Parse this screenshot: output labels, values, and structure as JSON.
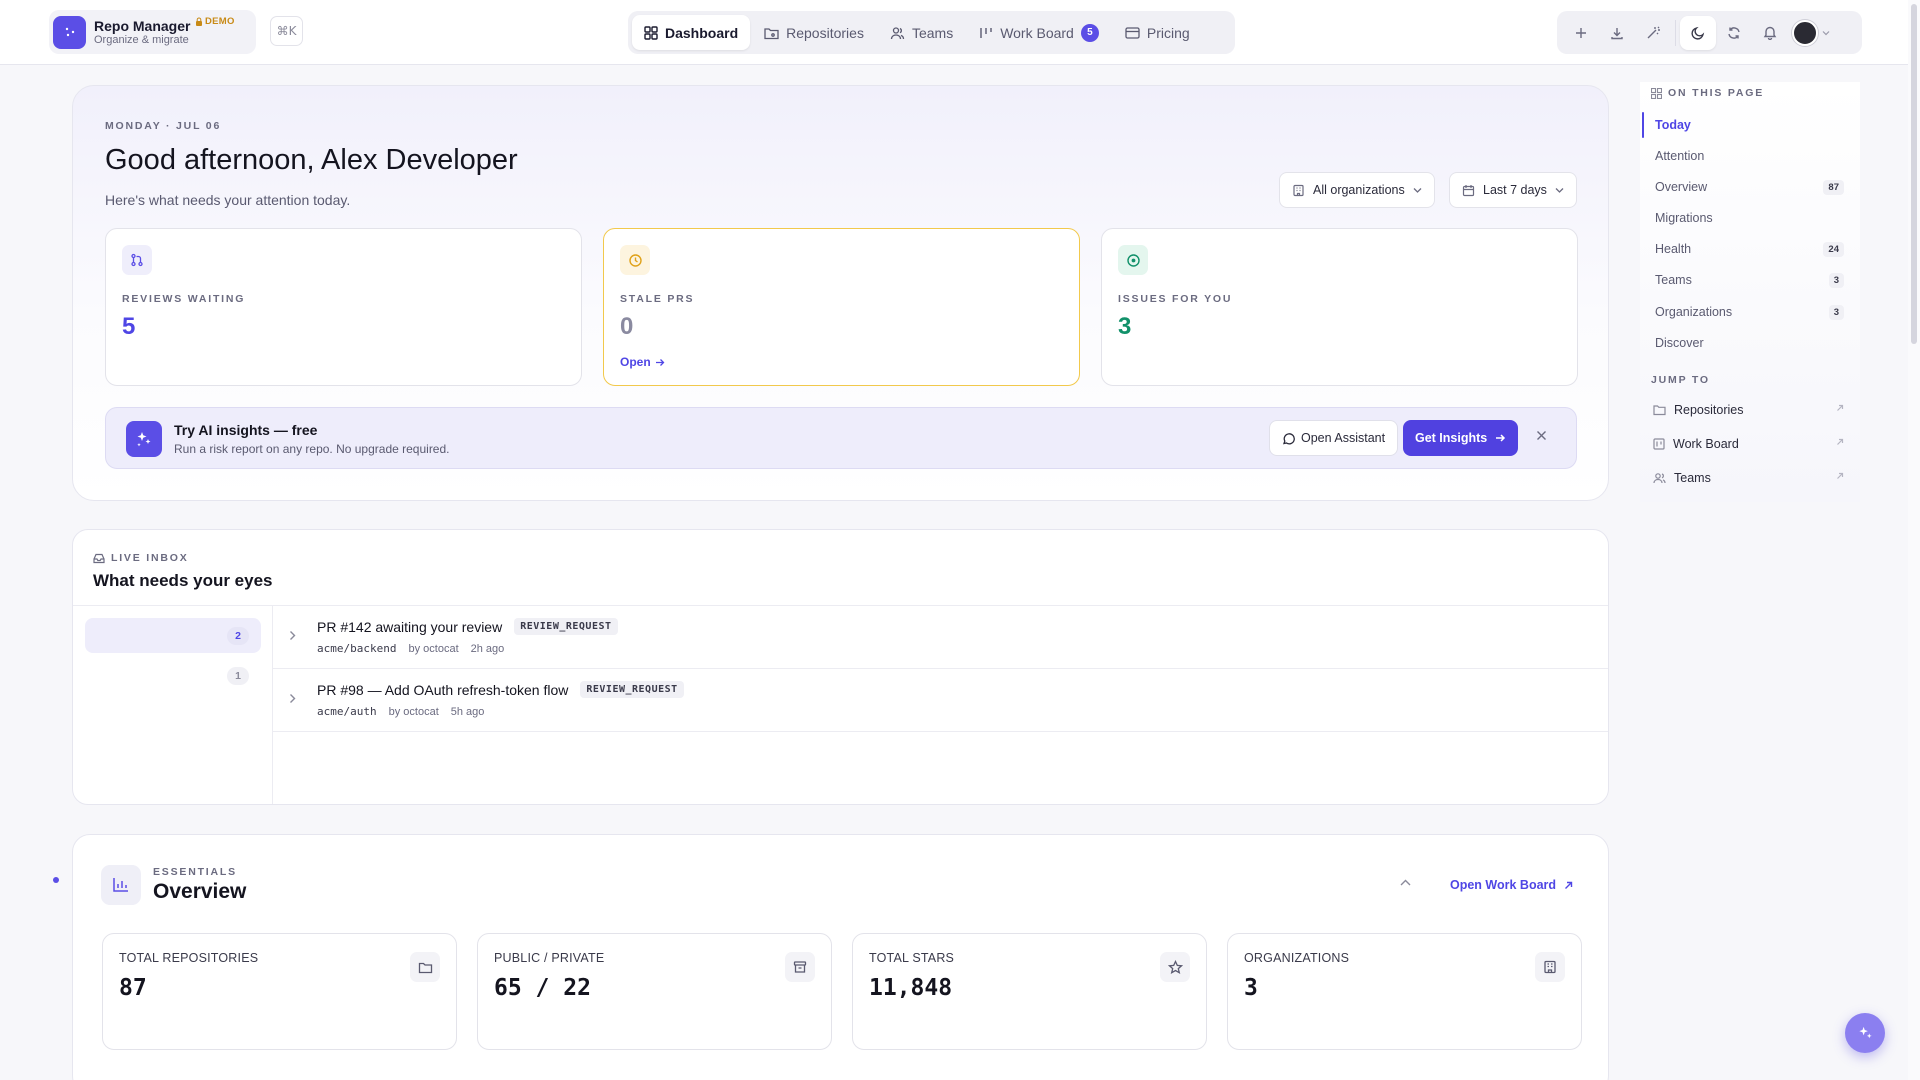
{
  "brand": {
    "name": "Repo Manager",
    "subtitle": "Organize & migrate",
    "badge": "DEMO",
    "shortcut": "⌘K"
  },
  "nav": {
    "dashboard": "Dashboard",
    "repositories": "Repositories",
    "teams": "Teams",
    "work_board": "Work Board",
    "work_board_count": "5",
    "pricing": "Pricing"
  },
  "hero": {
    "date": "MONDAY · JUL 06",
    "greeting": "Good afternoon, Alex Developer",
    "subtitle": "Here's what needs your attention today.",
    "org_filter": "All organizations",
    "range_filter": "Last 7 days"
  },
  "stats": [
    {
      "label": "REVIEWS WAITING",
      "value": "5",
      "color": "#4f46e5"
    },
    {
      "label": "STALE PRS",
      "value": "0",
      "link": "Open",
      "color": "#8a8aa0"
    },
    {
      "label": "ISSUES FOR YOU",
      "value": "3",
      "color": "#12916a"
    }
  ],
  "ai_banner": {
    "title": "Try AI insights — free",
    "subtitle": "Run a risk report on any repo. No upgrade required.",
    "assistant_button": "Open Assistant",
    "insights_button": "Get Insights"
  },
  "inbox": {
    "eyebrow": "LIVE INBOX",
    "title": "What needs your eyes",
    "filters": [
      {
        "count": "2"
      },
      {
        "count": "1"
      }
    ],
    "items": [
      {
        "title": "PR #142 awaiting your review",
        "tag": "REVIEW_REQUEST",
        "repo": "acme/backend",
        "author": "by octocat",
        "time": "2h ago"
      },
      {
        "title": "PR #98 — Add OAuth refresh-token flow",
        "tag": "REVIEW_REQUEST",
        "repo": "acme/auth",
        "author": "by octocat",
        "time": "5h ago"
      }
    ]
  },
  "overview": {
    "eyebrow": "ESSENTIALS",
    "title": "Overview",
    "link": "Open Work Board",
    "metrics": [
      {
        "label": "TOTAL REPOSITORIES",
        "value": "87",
        "icon": "folder-icon"
      },
      {
        "label": "PUBLIC / PRIVATE",
        "value": "65 / 22",
        "icon": "archive-icon"
      },
      {
        "label": "TOTAL STARS",
        "value": "11,848",
        "icon": "star-icon"
      },
      {
        "label": "ORGANIZATIONS",
        "value": "3",
        "icon": "building-icon"
      }
    ]
  },
  "rail": {
    "on_this_page": "ON THIS PAGE",
    "items": [
      {
        "label": "Today",
        "count": ""
      },
      {
        "label": "Attention",
        "count": ""
      },
      {
        "label": "Overview",
        "count": "87"
      },
      {
        "label": "Migrations",
        "count": ""
      },
      {
        "label": "Health",
        "count": "24"
      },
      {
        "label": "Teams",
        "count": "3"
      },
      {
        "label": "Organizations",
        "count": "3"
      },
      {
        "label": "Discover",
        "count": ""
      }
    ],
    "jump_to": "JUMP TO",
    "jump_items": [
      {
        "label": "Repositories"
      },
      {
        "label": "Work Board"
      },
      {
        "label": "Teams"
      }
    ]
  },
  "colors": {
    "accent": "#5041e0",
    "accent_soft": "#eeedfb",
    "warning": "#f2c94c",
    "success": "#12916a"
  }
}
